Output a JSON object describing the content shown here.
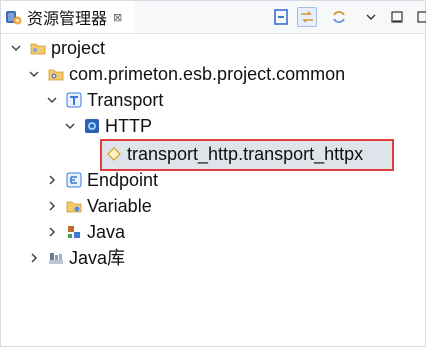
{
  "panel": {
    "title": "资源管理器",
    "close_glyph": "⊠"
  },
  "toolbar": {
    "buttons": [
      {
        "name": "collapse-all-icon"
      },
      {
        "name": "link-with-editor-icon",
        "active": true
      },
      {
        "name": "sync-icon"
      },
      {
        "name": "view-menu-icon"
      },
      {
        "name": "minimize-icon"
      },
      {
        "name": "maximize-icon"
      }
    ]
  },
  "tree": {
    "items": [
      {
        "label": "project",
        "icon": "project-folder-icon",
        "arrow": "expanded"
      },
      {
        "label": "com.primeton.esb.project.common",
        "icon": "package-gear-icon",
        "arrow": "expanded"
      },
      {
        "label": "Transport",
        "icon": "transport-icon",
        "arrow": "expanded"
      },
      {
        "label": "HTTP",
        "icon": "http-icon",
        "arrow": "expanded"
      },
      {
        "label": "transport_http.transport_httpx",
        "icon": "transport-file-icon",
        "arrow": "none",
        "selected": true
      },
      {
        "label": "Endpoint",
        "icon": "endpoint-icon",
        "arrow": "collapsed"
      },
      {
        "label": "Variable",
        "icon": "variable-folder-icon",
        "arrow": "collapsed"
      },
      {
        "label": "Java",
        "icon": "java-icon",
        "arrow": "collapsed"
      },
      {
        "label": "Java库",
        "icon": "java-library-icon",
        "arrow": "collapsed"
      }
    ]
  },
  "colors": {
    "selection_border": "#e23c3c",
    "selection_fill": "#dfe4ea",
    "toolbar_active": "#e6efff"
  }
}
